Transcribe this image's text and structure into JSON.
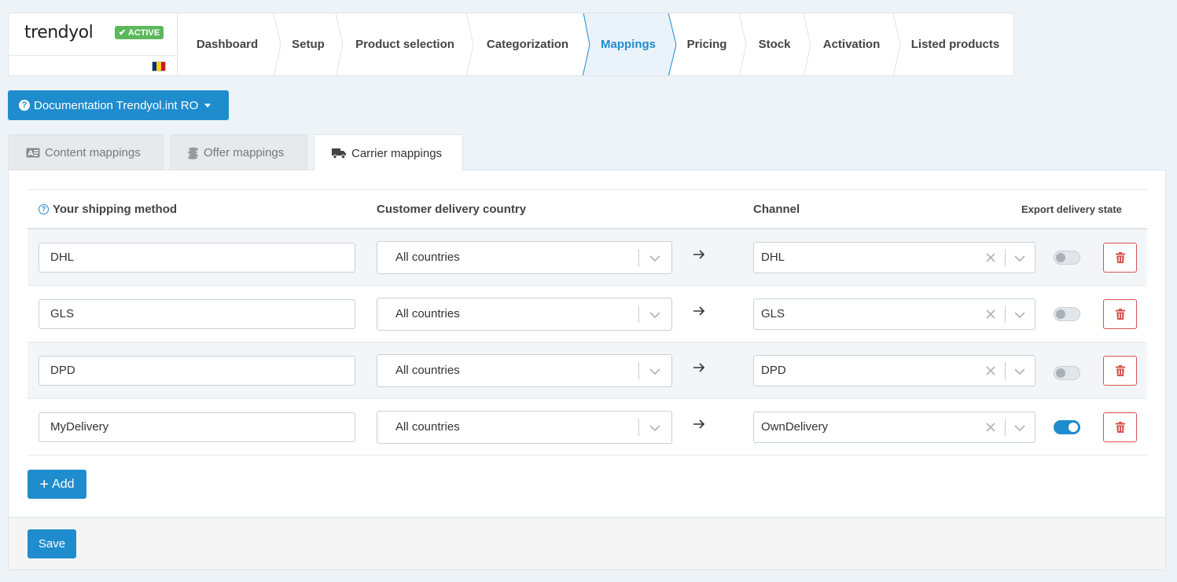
{
  "brand": {
    "logo_text": "trendyol",
    "status_badge": "ACTIVE",
    "flag_colors": [
      "#002b7f",
      "#fcd116",
      "#ce1126"
    ]
  },
  "steps": [
    {
      "label": "Dashboard",
      "active": false
    },
    {
      "label": "Setup",
      "active": false
    },
    {
      "label": "Product selection",
      "active": false
    },
    {
      "label": "Categorization",
      "active": false
    },
    {
      "label": "Mappings",
      "active": true
    },
    {
      "label": "Pricing",
      "active": false
    },
    {
      "label": "Stock",
      "active": false
    },
    {
      "label": "Activation",
      "active": false
    },
    {
      "label": "Listed products",
      "active": false
    }
  ],
  "documentation_button": "Documentation Trendyol.int RO",
  "tabs": [
    {
      "label": "Content mappings",
      "icon": "id-card-icon",
      "active": false
    },
    {
      "label": "Offer mappings",
      "icon": "coins-icon",
      "active": false
    },
    {
      "label": "Carrier mappings",
      "icon": "truck-icon",
      "active": true
    }
  ],
  "table": {
    "headers": {
      "shipping_method": "Your shipping method",
      "country": "Customer delivery country",
      "channel": "Channel",
      "export_state": "Export delivery state"
    },
    "rows": [
      {
        "method": "DHL",
        "country": "All countries",
        "channel": "DHL",
        "export": false
      },
      {
        "method": "GLS",
        "country": "All countries",
        "channel": "GLS",
        "export": false
      },
      {
        "method": "DPD",
        "country": "All countries",
        "channel": "DPD",
        "export": false
      },
      {
        "method": "MyDelivery",
        "country": "All countries",
        "channel": "OwnDelivery",
        "export": true
      }
    ]
  },
  "buttons": {
    "add": "Add",
    "save": "Save"
  },
  "colors": {
    "accent": "#1f8ccd",
    "success": "#5cb85c",
    "danger": "#d9534f"
  }
}
